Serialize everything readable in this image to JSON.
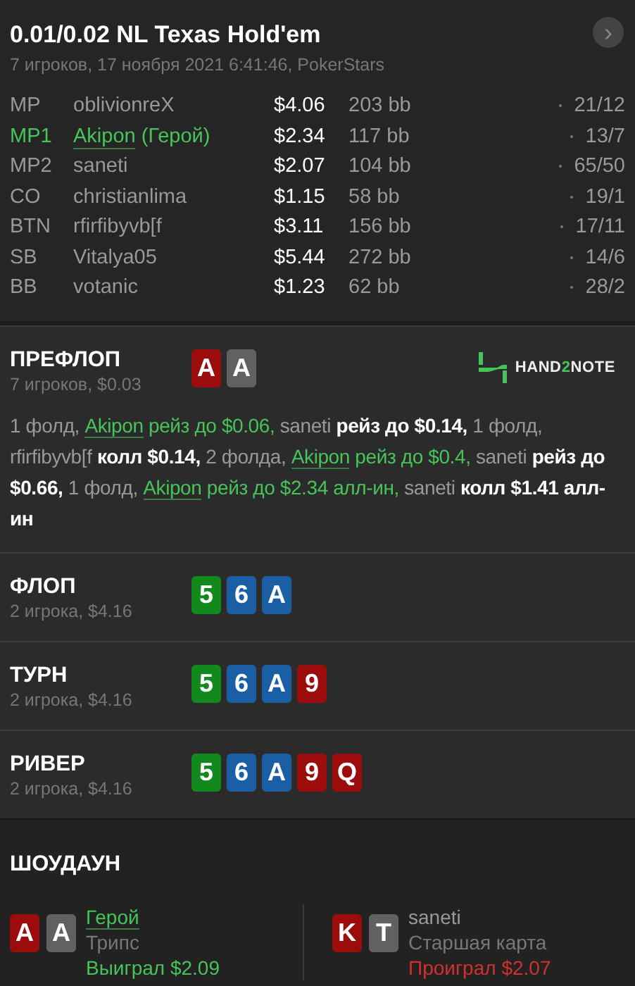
{
  "header": {
    "title": "0.01/0.02 NL Texas Hold'em",
    "subtitle": "7 игроков, 17 ноября 2021 6:41:46, PokerStars",
    "next_button": "›"
  },
  "players": [
    {
      "position": "MP",
      "name": "oblivionreX",
      "hero": false,
      "stack": "$4.06",
      "bb": "203 bb",
      "stats": "21/12"
    },
    {
      "position": "MP1",
      "name": "Akipon",
      "note": "(Герой)",
      "hero": true,
      "stack": "$2.34",
      "bb": "117 bb",
      "stats": "13/7"
    },
    {
      "position": "MP2",
      "name": "saneti",
      "hero": false,
      "stack": "$2.07",
      "bb": "104 bb",
      "stats": "65/50"
    },
    {
      "position": "CO",
      "name": "christianlima",
      "hero": false,
      "stack": "$1.15",
      "bb": "58 bb",
      "stats": "19/1"
    },
    {
      "position": "BTN",
      "name": "rfirfibyvb[f",
      "hero": false,
      "stack": "$3.11",
      "bb": "156 bb",
      "stats": "17/11"
    },
    {
      "position": "SB",
      "name": "Vitalya05",
      "hero": false,
      "stack": "$5.44",
      "bb": "272 bb",
      "stats": "14/6"
    },
    {
      "position": "BB",
      "name": "votanic",
      "hero": false,
      "stack": "$1.23",
      "bb": "62 bb",
      "stats": "28/2"
    }
  ],
  "streets": [
    {
      "title": "ПРЕФЛОП",
      "subtitle": "7 игроков, $0.03",
      "logo": {
        "before": "HAND",
        "accent": "2",
        "after": "NOTE"
      },
      "cards": [
        {
          "rank": "A",
          "color": "#9c0c0c"
        },
        {
          "rank": "A",
          "color": "#616161"
        }
      ],
      "actions": [
        {
          "kind": "text",
          "text": "1 фолд, "
        },
        {
          "kind": "hero",
          "text": "Akipon"
        },
        {
          "kind": "hero-action",
          "text": " рейз до $0.06, "
        },
        {
          "kind": "text",
          "text": "saneti "
        },
        {
          "kind": "action",
          "text": "рейз до $0.14, "
        },
        {
          "kind": "text",
          "text": "1 фолд, rfirfibyvb[f "
        },
        {
          "kind": "action",
          "text": "колл $0.14, "
        },
        {
          "kind": "text",
          "text": "2 фолда, "
        },
        {
          "kind": "hero",
          "text": "Akipon"
        },
        {
          "kind": "hero-action",
          "text": " рейз до $0.4, "
        },
        {
          "kind": "text",
          "text": "saneti "
        },
        {
          "kind": "action",
          "text": "рейз до $0.66, "
        },
        {
          "kind": "text",
          "text": "1 фолд, "
        },
        {
          "kind": "hero",
          "text": "Akipon"
        },
        {
          "kind": "hero-action",
          "text": " рейз до $2.34 алл-ин, "
        },
        {
          "kind": "text",
          "text": "saneti "
        },
        {
          "kind": "action",
          "text": "колл $1.41 алл-ин"
        }
      ]
    },
    {
      "title": "ФЛОП",
      "subtitle": "2 игрока, $4.16",
      "cards": [
        {
          "rank": "5",
          "color": "#12891c"
        },
        {
          "rank": "6",
          "color": "#1a5ea6"
        },
        {
          "rank": "A",
          "color": "#1a5ea6"
        }
      ]
    },
    {
      "title": "ТУРН",
      "subtitle": "2 игрока, $4.16",
      "cards": [
        {
          "rank": "5",
          "color": "#12891c"
        },
        {
          "rank": "6",
          "color": "#1a5ea6"
        },
        {
          "rank": "A",
          "color": "#1a5ea6"
        },
        {
          "rank": "9",
          "color": "#9c0c0c"
        }
      ]
    },
    {
      "title": "РИВЕР",
      "subtitle": "2 игрока, $4.16",
      "cards": [
        {
          "rank": "5",
          "color": "#12891c"
        },
        {
          "rank": "6",
          "color": "#1a5ea6"
        },
        {
          "rank": "A",
          "color": "#1a5ea6"
        },
        {
          "rank": "9",
          "color": "#9c0c0c"
        },
        {
          "rank": "Q",
          "color": "#9c0c0c"
        }
      ]
    }
  ],
  "showdown": {
    "title": "ШОУДАУН",
    "hands": [
      {
        "name": "Герой",
        "hero": true,
        "hand": "Трипс",
        "result": "Выиграл $2.09",
        "won": true,
        "cards": [
          {
            "rank": "A",
            "color": "#9c0c0c"
          },
          {
            "rank": "A",
            "color": "#616161"
          }
        ]
      },
      {
        "name": "saneti",
        "hero": false,
        "hand": "Старшая карта",
        "result": "Проиграл $2.07",
        "won": false,
        "cards": [
          {
            "rank": "K",
            "color": "#9c0c0c"
          },
          {
            "rank": "T",
            "color": "#616161"
          }
        ]
      }
    ]
  }
}
